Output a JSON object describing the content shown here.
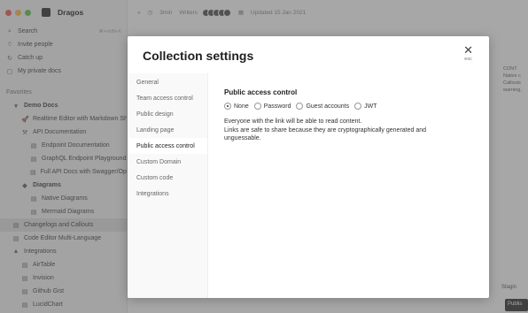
{
  "sidebar": {
    "workspace": "Dragos",
    "search_label": "Search",
    "search_hint": "⌘+shift+K",
    "items_top": [
      {
        "icon": "invite-people-icon",
        "glyph": "⍥",
        "label": "Invite people"
      },
      {
        "icon": "catch-up-icon",
        "glyph": "↻",
        "label": "Catch up"
      },
      {
        "icon": "private-docs-icon",
        "glyph": "▢",
        "label": "My private docs"
      }
    ],
    "favorites_label": "Favorites",
    "tree": [
      {
        "level": 1,
        "glyph": "▾",
        "label": "Demo Docs",
        "bold": true,
        "active": false
      },
      {
        "level": 2,
        "glyph": "🚀",
        "label": "Realtime Editor with Markdown Sh",
        "bold": false,
        "active": false
      },
      {
        "level": 2,
        "glyph": "⚒",
        "label": "API Documentation",
        "bold": false,
        "active": false
      },
      {
        "level": 3,
        "glyph": "▤",
        "label": "Endpoint Documentation",
        "bold": false,
        "active": false
      },
      {
        "level": 3,
        "glyph": "▤",
        "label": "GraphQL Endpoint Playground",
        "bold": false,
        "active": false
      },
      {
        "level": 3,
        "glyph": "▤",
        "label": "Full API Docs with Swagger/Ope",
        "bold": false,
        "active": false
      },
      {
        "level": 2,
        "glyph": "◆",
        "label": "Diagrams",
        "bold": true,
        "active": false
      },
      {
        "level": 3,
        "glyph": "▤",
        "label": "Native Diagrams",
        "bold": false,
        "active": false
      },
      {
        "level": 3,
        "glyph": "▤",
        "label": "Mermaid Diagrams",
        "bold": false,
        "active": false
      },
      {
        "level": 1,
        "glyph": "▤",
        "label": "Changelogs and Callouts",
        "bold": false,
        "active": true
      },
      {
        "level": 1,
        "glyph": "▤",
        "label": "Code Editor Multi-Language",
        "bold": false,
        "active": false
      },
      {
        "level": 1,
        "glyph": "▲",
        "label": "Integrations",
        "bold": false,
        "active": false
      },
      {
        "level": 2,
        "glyph": "▤",
        "label": "AirTable",
        "bold": false,
        "active": false
      },
      {
        "level": 2,
        "glyph": "▤",
        "label": "Invision",
        "bold": false,
        "active": false
      },
      {
        "level": 2,
        "glyph": "▤",
        "label": "Github Gist",
        "bold": false,
        "active": false
      },
      {
        "level": 2,
        "glyph": "▤",
        "label": "LucidChart",
        "bold": false,
        "active": false
      }
    ]
  },
  "topbar": {
    "time_ago": "3min",
    "writers_label": "Writers",
    "updated": "Updated 15 Jan 2021"
  },
  "right_panel": {
    "heading": "CONT",
    "lines": [
      "Native c",
      "Callouts",
      "warning,"
    ]
  },
  "bottom_right": {
    "label": "Stagin",
    "button": "Publis"
  },
  "modal": {
    "title": "Collection settings",
    "close_label": "esc",
    "tabs": [
      {
        "label": "General",
        "active": false
      },
      {
        "label": "Team access control",
        "active": false
      },
      {
        "label": "Public design",
        "active": false
      },
      {
        "label": "Landing page",
        "active": false
      },
      {
        "label": "Public access control",
        "active": true
      },
      {
        "label": "Custom Domain",
        "active": false
      },
      {
        "label": "Custom code",
        "active": false
      },
      {
        "label": "Integrations",
        "active": false
      }
    ],
    "section_title": "Public access control",
    "options": [
      {
        "label": "None",
        "selected": true
      },
      {
        "label": "Password",
        "selected": false
      },
      {
        "label": "Guest accounts",
        "selected": false
      },
      {
        "label": "JWT",
        "selected": false
      }
    ],
    "description_1": "Everyone with the link will be able to read content.",
    "description_2": "Links are safe to share because they are cryptographically generated and unguessable."
  }
}
